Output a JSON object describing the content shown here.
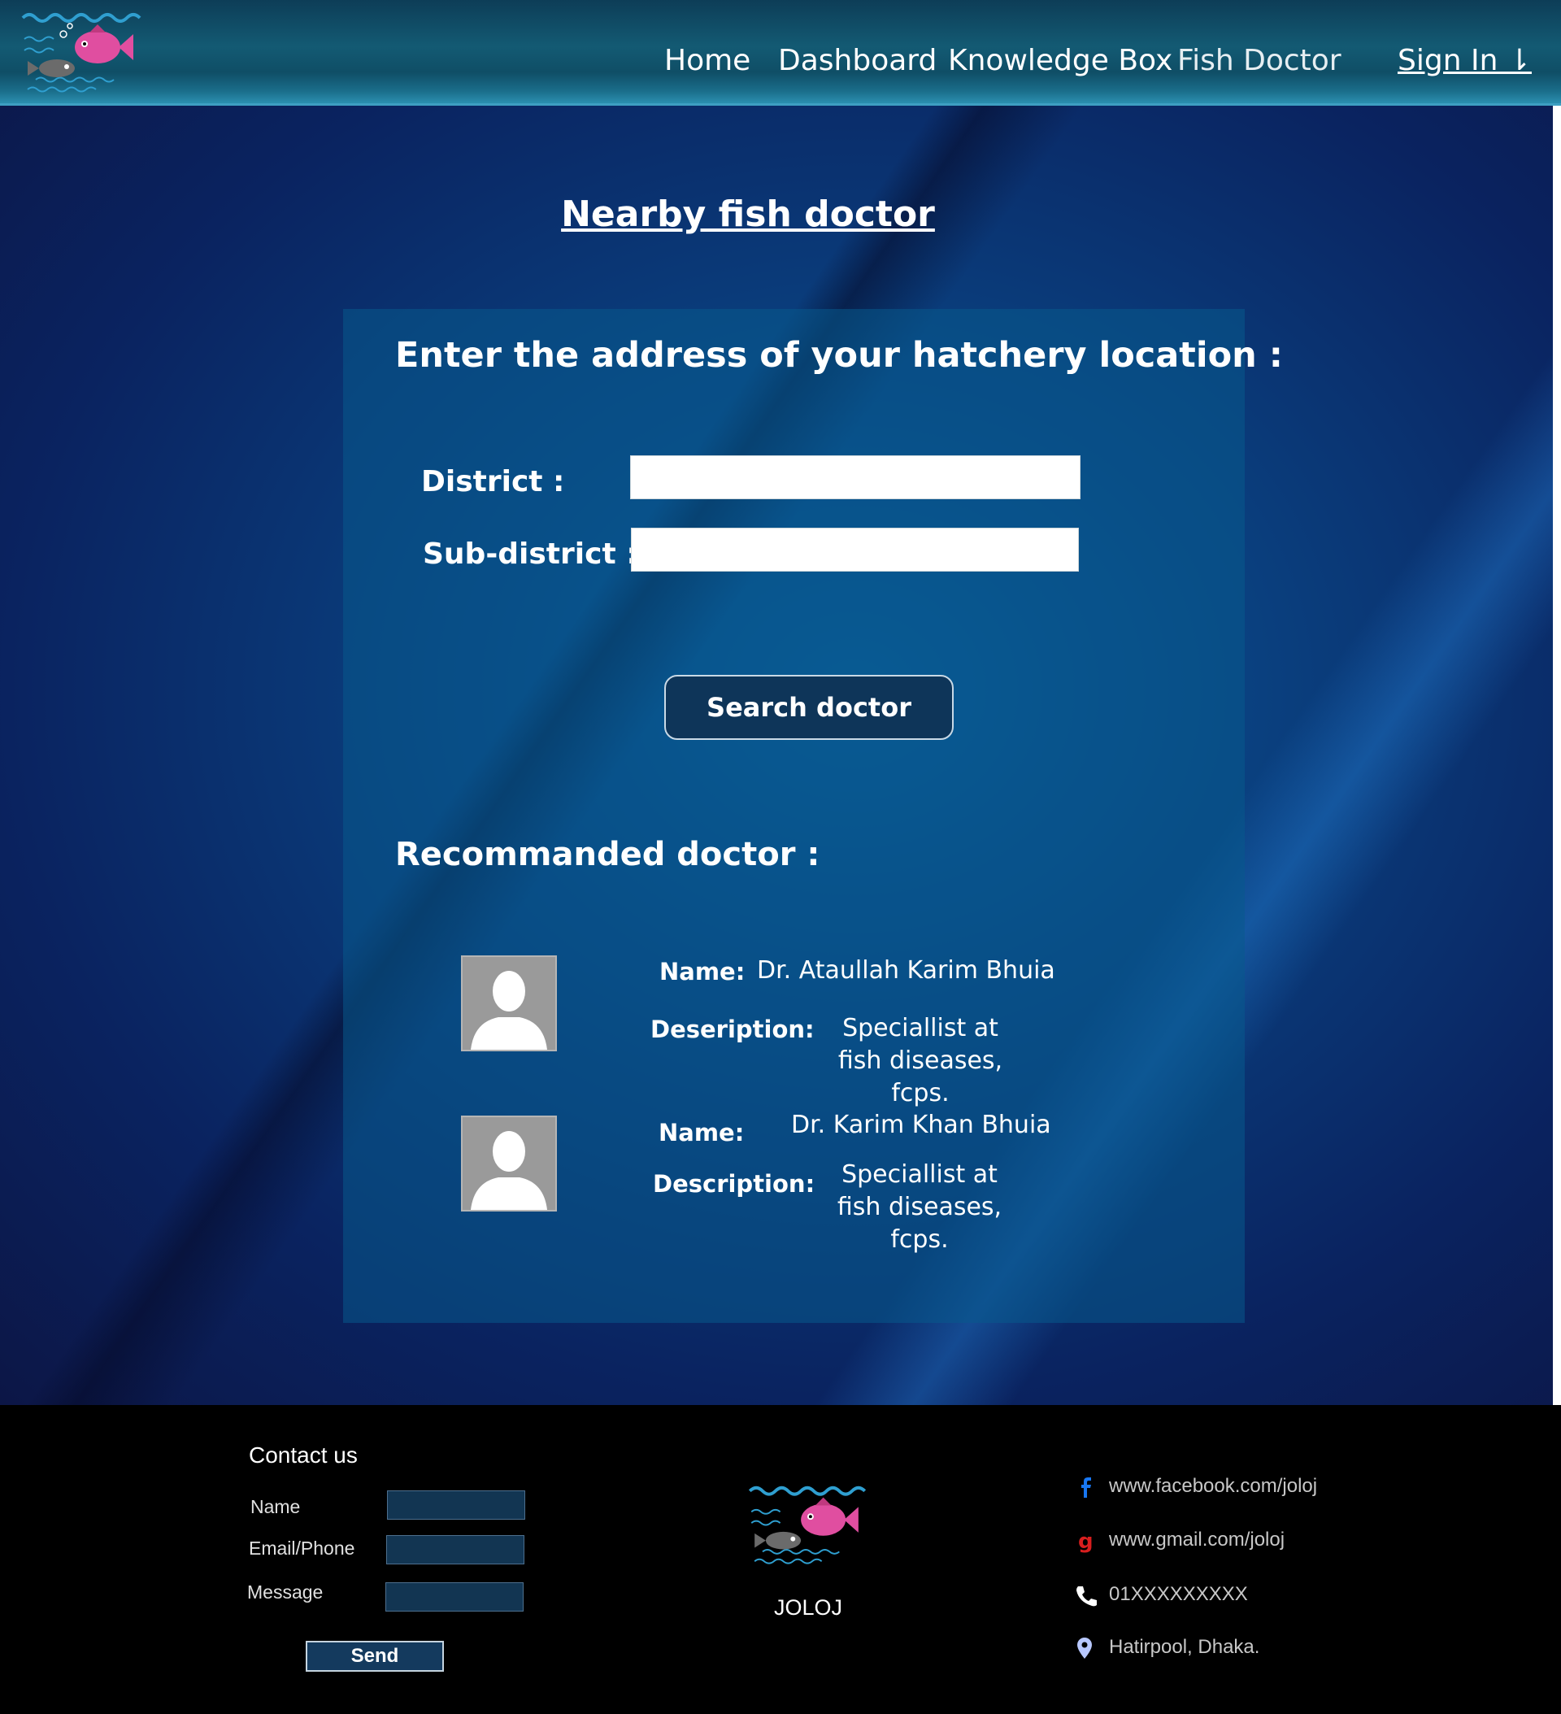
{
  "header": {
    "nav": {
      "home": "Home",
      "dashboard": "Dashboard",
      "knowledge_box": "Knowledge Box",
      "fish_doctor": "Fish Doctor"
    },
    "sign_in": "Sign In ⇂"
  },
  "main": {
    "title": "Nearby fish doctor",
    "form": {
      "heading": "Enter the address of your hatchery location :",
      "district_label": "District :",
      "district_value": "",
      "subdistrict_label": "Sub-district :",
      "subdistrict_value": "",
      "search_button": "Search doctor"
    },
    "recommended": {
      "heading": "Recommanded doctor :",
      "doctors": [
        {
          "name_label": "Name:",
          "name": "Dr. Ataullah Karim Bhuia",
          "desc_label": "Deseription:",
          "description": "Speciallist at fish diseases, fcps."
        },
        {
          "name_label": "Name:",
          "name": "Dr. Karim Khan Bhuia",
          "desc_label": "Description:",
          "description": "Speciallist at fish diseases, fcps."
        }
      ]
    }
  },
  "footer": {
    "contact_title": "Contact us",
    "fields": {
      "name_label": "Name",
      "email_label": "Email/Phone",
      "message_label": "Message"
    },
    "send_button": "Send",
    "brand": "JOLOJ",
    "links": {
      "facebook": "www.facebook.com/joloj",
      "gmail": "www.gmail.com/joloj",
      "phone": "01XXXXXXXXX",
      "address": "Hatirpool, Dhaka."
    }
  },
  "colors": {
    "accent_blue": "#0e3559",
    "fish_pink": "#e04ea0",
    "water_blue": "#2f9fd0"
  }
}
